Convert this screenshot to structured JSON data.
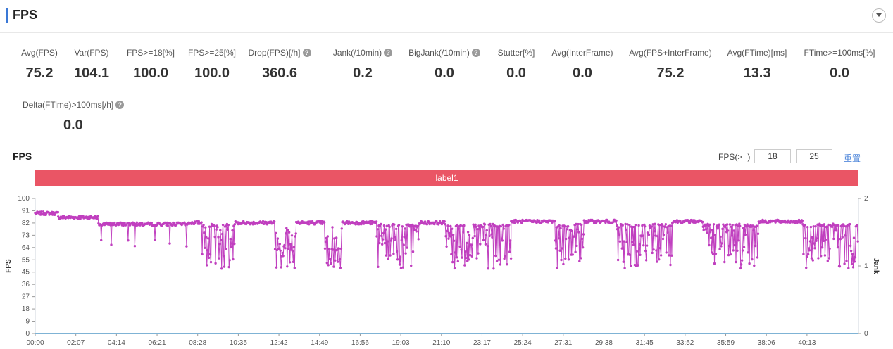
{
  "header": {
    "title": "FPS",
    "collapse_icon": "chevron-down-icon"
  },
  "metrics": [
    {
      "label": "Avg(FPS)",
      "value": "75.2",
      "help": false
    },
    {
      "label": "Var(FPS)",
      "value": "104.1",
      "help": false
    },
    {
      "label": "FPS>=18[%]",
      "value": "100.0",
      "help": false
    },
    {
      "label": "FPS>=25[%]",
      "value": "100.0",
      "help": false
    },
    {
      "label": "Drop(FPS)[/h]",
      "value": "360.6",
      "help": true
    },
    {
      "label": "Jank(/10min)",
      "value": "0.2",
      "help": true
    },
    {
      "label": "BigJank(/10min)",
      "value": "0.0",
      "help": true
    },
    {
      "label": "Stutter[%]",
      "value": "0.0",
      "help": false
    },
    {
      "label": "Avg(InterFrame)",
      "value": "0.0",
      "help": false
    },
    {
      "label": "Avg(FPS+InterFrame)",
      "value": "75.2",
      "help": false
    },
    {
      "label": "Avg(FTime)[ms]",
      "value": "13.3",
      "help": false
    },
    {
      "label": "FTime>=100ms[%]",
      "value": "0.0",
      "help": false
    },
    {
      "label": "Delta(FTime)>100ms[/h]",
      "value": "0.0",
      "help": true
    }
  ],
  "chart": {
    "title": "FPS",
    "threshold_label": "FPS(>=)",
    "threshold_1": "18",
    "threshold_2": "25",
    "reset_label": "重置",
    "label_bar": "label1",
    "label_bar_color": "#ea5565"
  },
  "chart_data": {
    "type": "line",
    "ylabel": "FPS",
    "y2label": "Jank",
    "ylim": [
      0,
      100
    ],
    "y2lim": [
      0,
      2
    ],
    "yticks": [
      "0",
      "9",
      "18",
      "27",
      "36",
      "45",
      "55",
      "64",
      "73",
      "82",
      "91",
      "100"
    ],
    "y2ticks": [
      "0",
      "1",
      "2"
    ],
    "xticks": [
      "00:00",
      "02:07",
      "04:14",
      "06:21",
      "08:28",
      "10:35",
      "12:42",
      "14:49",
      "16:56",
      "19:03",
      "21:10",
      "23:17",
      "25:24",
      "27:31",
      "29:38",
      "31:45",
      "33:52",
      "35:59",
      "38:06",
      "40:13"
    ],
    "x_range_minutes": [
      0,
      42.9
    ],
    "series_color": "#c03fbf",
    "segments": [
      {
        "start": 0.0,
        "end": 1.2,
        "base": 89,
        "style": "stable"
      },
      {
        "start": 1.2,
        "end": 3.3,
        "base": 86,
        "style": "stable"
      },
      {
        "start": 3.3,
        "end": 8.0,
        "base": 81,
        "style": "spiky"
      },
      {
        "start": 8.0,
        "end": 8.7,
        "base": 82,
        "style": "stable"
      },
      {
        "start": 8.7,
        "end": 10.4,
        "base": 80,
        "style": "volatile"
      },
      {
        "start": 10.4,
        "end": 12.5,
        "base": 82,
        "style": "stable"
      },
      {
        "start": 12.5,
        "end": 13.6,
        "base": 62,
        "style": "volatile"
      },
      {
        "start": 13.6,
        "end": 15.1,
        "base": 82,
        "style": "stable"
      },
      {
        "start": 15.1,
        "end": 16.0,
        "base": 62,
        "style": "volatile"
      },
      {
        "start": 16.0,
        "end": 17.8,
        "base": 82,
        "style": "stable"
      },
      {
        "start": 17.8,
        "end": 20.0,
        "base": 80,
        "style": "volatile"
      },
      {
        "start": 20.0,
        "end": 21.4,
        "base": 82,
        "style": "stable"
      },
      {
        "start": 21.4,
        "end": 24.8,
        "base": 80,
        "style": "volatile"
      },
      {
        "start": 24.8,
        "end": 27.1,
        "base": 83,
        "style": "stable"
      },
      {
        "start": 27.1,
        "end": 28.6,
        "base": 80,
        "style": "volatile"
      },
      {
        "start": 28.6,
        "end": 30.3,
        "base": 83,
        "style": "stable"
      },
      {
        "start": 30.3,
        "end": 33.2,
        "base": 80,
        "style": "volatile"
      },
      {
        "start": 33.2,
        "end": 34.8,
        "base": 83,
        "style": "stable"
      },
      {
        "start": 34.8,
        "end": 37.7,
        "base": 80,
        "style": "volatile"
      },
      {
        "start": 37.7,
        "end": 40.0,
        "base": 83,
        "style": "stable"
      },
      {
        "start": 40.0,
        "end": 42.9,
        "base": 80,
        "style": "volatile"
      }
    ]
  }
}
